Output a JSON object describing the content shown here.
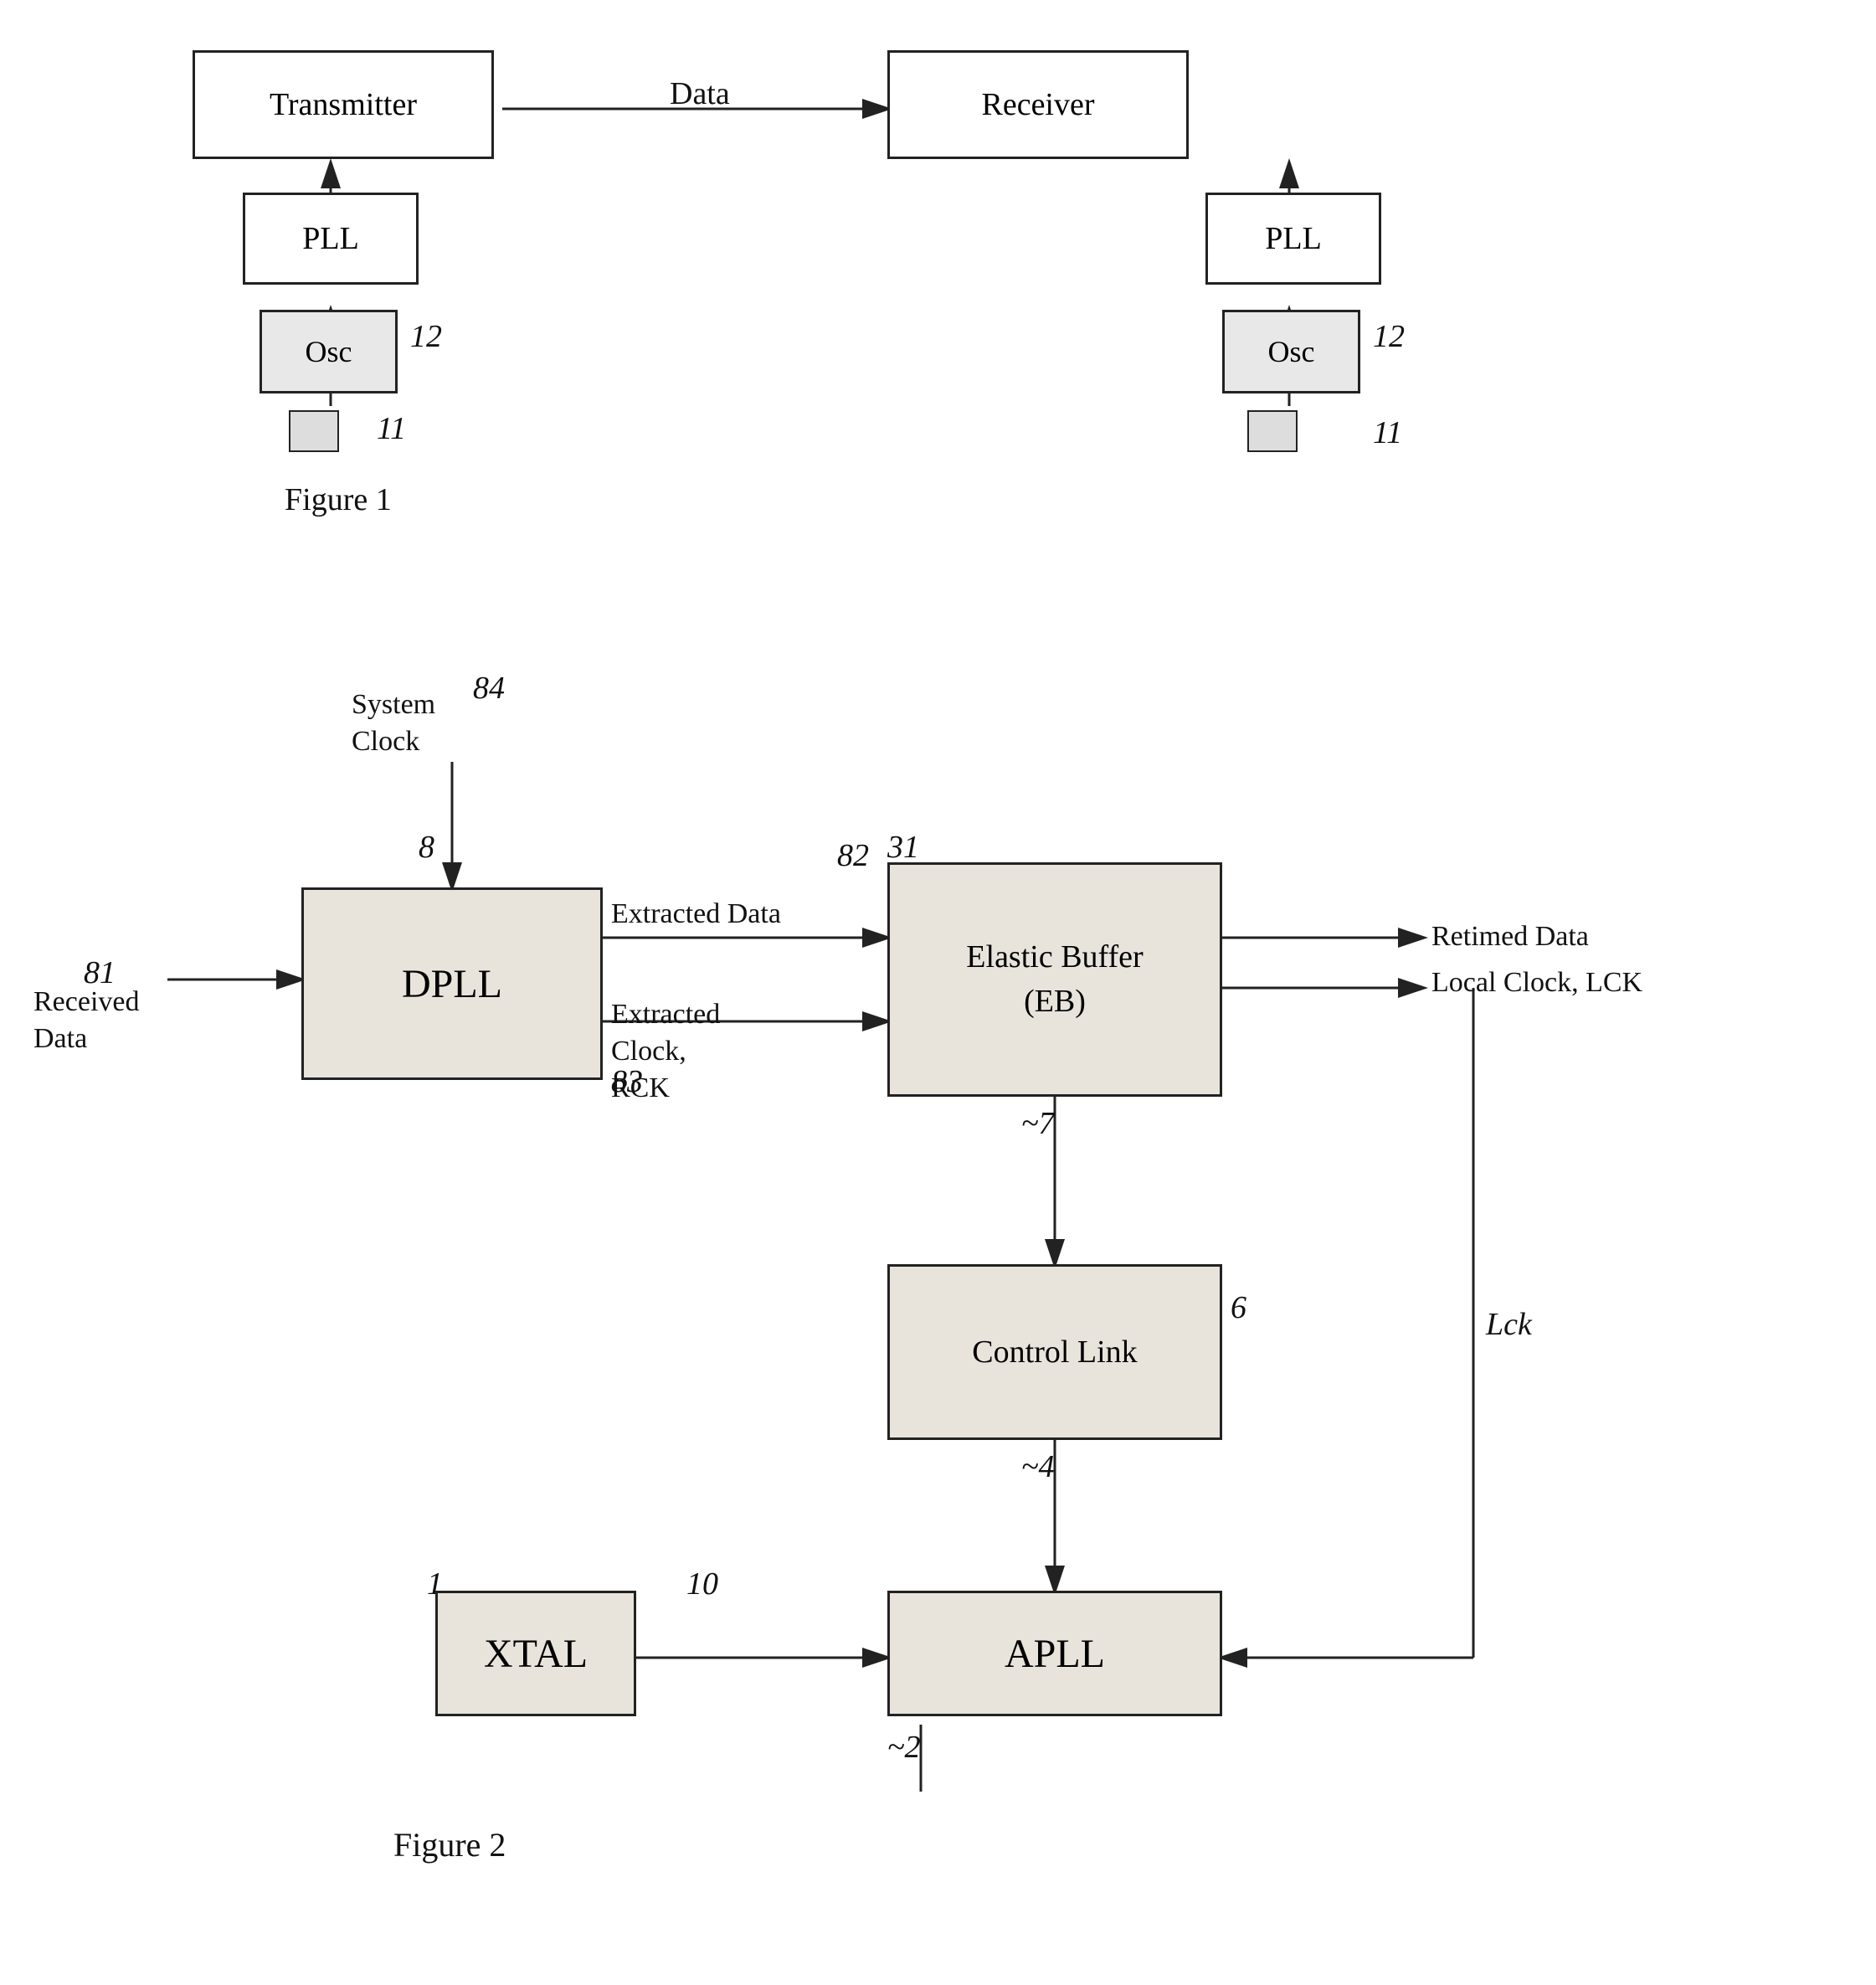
{
  "figure1": {
    "title": "Figure 1",
    "left": {
      "transmitter": "Transmitter",
      "pll": "PLL",
      "osc": "Osc",
      "label12": "12",
      "label11": "11"
    },
    "right": {
      "receiver": "Receiver",
      "pll": "PLL",
      "osc": "Osc",
      "label12": "12",
      "label11": "11"
    },
    "data_label": "Data"
  },
  "figure2": {
    "title": "Figure 2",
    "blocks": {
      "dpll": "DPLL",
      "elastic_buffer": "Elastic Buffer\n(EB)",
      "control_link": "Control Link",
      "apll": "APLL",
      "xtal": "XTAL"
    },
    "labels": {
      "system_clock": "System\nClock",
      "received_data": "Received\nData",
      "extracted_data": "Extracted Data",
      "extracted_clock": "Extracted\nClock,\nRCK",
      "retimed_data": "Retimed Data",
      "local_clock": "Local Clock, LCK",
      "lck": "Lck",
      "ref84": "84",
      "ref8": "8",
      "ref82": "82",
      "ref81": "81",
      "ref31": "31",
      "ref83": "83",
      "ref7": "~7",
      "ref6": "6",
      "ref4": "~4",
      "ref2": "~2",
      "ref10": "10",
      "ref1": "1"
    }
  }
}
